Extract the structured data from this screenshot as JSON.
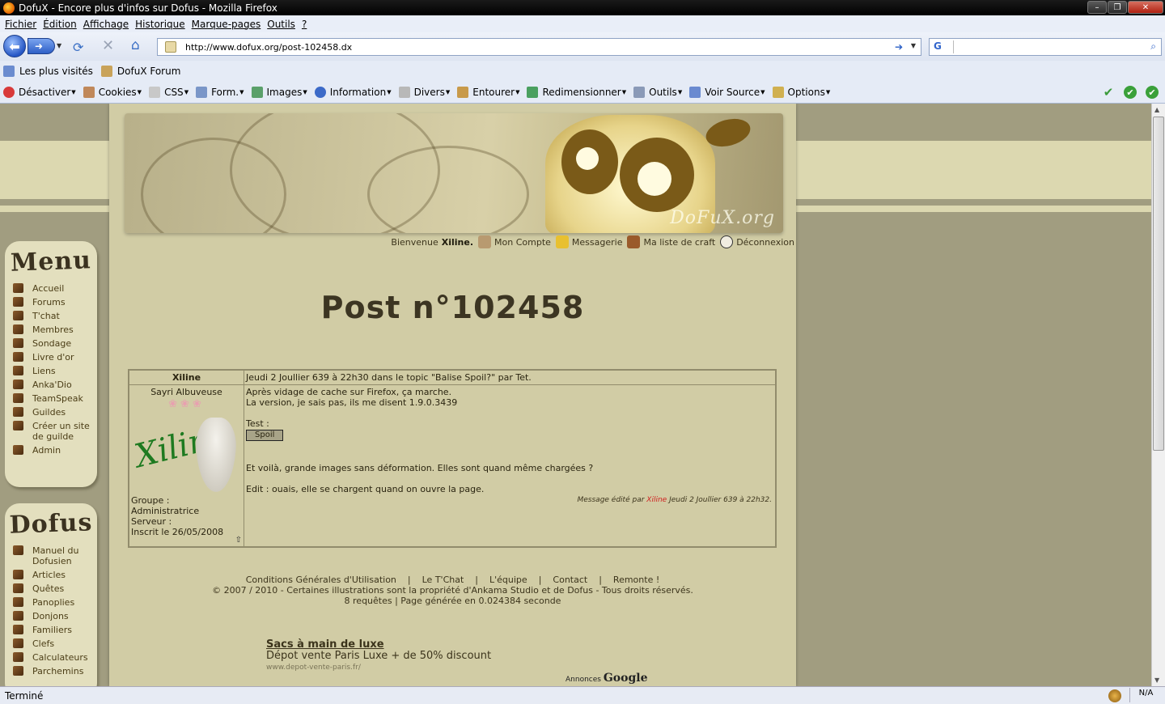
{
  "window": {
    "title": "DofuX - Encore plus d'infos sur Dofus - Mozilla Firefox",
    "buttons": [
      "–",
      "❐",
      "✕"
    ]
  },
  "menubar": [
    "Fichier",
    "Édition",
    "Affichage",
    "Historique",
    "Marque-pages",
    "Outils",
    "?"
  ],
  "navbar": {
    "url": "http://www.dofux.org/post-102458.dx",
    "search_engine": "G"
  },
  "bookmarks": [
    "Les plus visités",
    "DofuX Forum"
  ],
  "devtoolbar": [
    "Désactiver",
    "Cookies",
    "CSS",
    "Form.",
    "Images",
    "Information",
    "Divers",
    "Entourer",
    "Redimensionner",
    "Outils",
    "Voir Source",
    "Options"
  ],
  "sidebar": {
    "menu_title": "Menu",
    "menu_items": [
      "Accueil",
      "Forums",
      "T'chat",
      "Membres",
      "Sondage",
      "Livre d'or",
      "Liens",
      "Anka'Dio",
      "TeamSpeak",
      "Guildes",
      "Créer un site de guilde",
      "Admin"
    ],
    "dofus_title": "Dofus",
    "dofus_items": [
      "Manuel du Dofusien",
      "Articles",
      "Quêtes",
      "Panoplies",
      "Donjons",
      "Familiers",
      "Clefs",
      "Calculateurs",
      "Parchemins"
    ]
  },
  "banner": {
    "logo_text": "DoFuX.org"
  },
  "welcome": {
    "prefix": "Bienvenue",
    "user": "Xiline.",
    "account": "Mon Compte",
    "messages": "Messagerie",
    "craft": "Ma liste de craft",
    "logout": "Déconnexion"
  },
  "post": {
    "title": "Post n°102458",
    "author": "Xiline",
    "header": "Jeudi 2 Joullier 639 à 22h30 dans le topic \"Balise Spoil?\" par Tet.",
    "user_title": "Sayri Albuveuse",
    "signature": "Xiline",
    "group_label": "Groupe :",
    "group": "Administratrice",
    "server_label": "Serveur :",
    "registered": "Inscrit le 26/05/2008",
    "line1": "Après vidage de cache sur Firefox, ça marche.",
    "line2": "La version, je sais pas, ils me disent 1.9.0.3439",
    "test": "Test :",
    "spoil": "Spoil",
    "line3": "Et voilà, grande images sans déformation. Elles sont quand même chargées ?",
    "line4": "Edit : ouais, elle se chargent quand on ouvre la page.",
    "edited_prefix": "Message édité par",
    "edited_user": "Xiline",
    "edited_date": "Jeudi 2 Joullier 639 à 22h32."
  },
  "footer": {
    "links": [
      "Conditions Générales d'Utilisation",
      "|",
      "Le T'Chat",
      "|",
      "L'équipe",
      "|",
      "Contact",
      "|",
      "Remonte !"
    ],
    "copyright": "© 2007 / 2010 - Certaines illustrations sont la propriété d'Ankama Studio et de Dofus - Tous droits réservés.",
    "stats": "8 requêtes | Page générée en 0.024384 seconde"
  },
  "ad": {
    "title": "Sacs à main de luxe",
    "text": "Dépot vente Paris Luxe + de 50% discount",
    "url": "www.depot-vente-paris.fr/",
    "by_prefix": "Annonces",
    "by_brand": "Google"
  },
  "statusbar": {
    "text": "Terminé",
    "na": "N/A"
  }
}
